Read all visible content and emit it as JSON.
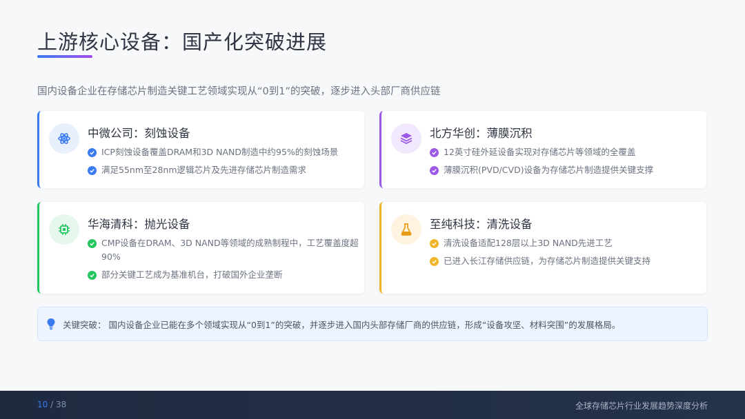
{
  "page": {
    "title": "上游核心设备：国产化突破进展",
    "subtitle": "国内设备企业在存储芯片制造关键工艺领域实现从“0到1”的突破，逐步进入头部厂商供应链"
  },
  "cards": [
    {
      "title": "中微公司：刻蚀设备",
      "icon": "atom-icon",
      "color": "#3b7bf0",
      "items": [
        "ICP刻蚀设备覆盖DRAM和3D NAND制造中约95%的刻蚀场景",
        "满足55nm至28nm逻辑芯片及先进存储芯片制造需求"
      ]
    },
    {
      "title": "北方华创：薄膜沉积",
      "icon": "layers-icon",
      "color": "#9b59e6",
      "items": [
        "12英寸硅外延设备实现对存储芯片等领域的全覆盖",
        "薄膜沉积(PVD/CVD)设备为存储芯片制造提供关键支撑"
      ]
    },
    {
      "title": "华海清科：抛光设备",
      "icon": "chip-icon",
      "color": "#22c55e",
      "items": [
        "CMP设备在DRAM、3D NAND等领域的成熟制程中，工艺覆盖度超90%",
        "部分关键工艺成为基准机台，打破国外企业垄断"
      ]
    },
    {
      "title": "至纯科技：清洗设备",
      "icon": "flask-icon",
      "color": "#f0b429",
      "items": [
        "清洗设备适配128层以上3D NAND先进工艺",
        "已进入长江存储供应链，为存储芯片制造提供关键支持"
      ]
    }
  ],
  "callout": {
    "icon": "lightbulb-icon",
    "text": "关键突破：  国内设备企业已能在多个领域实现从“0到1”的突破，并逐步进入国内头部存储厂商的供应链，形成“设备攻坚、材料突围”的发展格局。"
  },
  "footer": {
    "current_page": "10",
    "separator": " / 38",
    "deck_title": "全球存储芯片行业发展趋势深度分析"
  }
}
